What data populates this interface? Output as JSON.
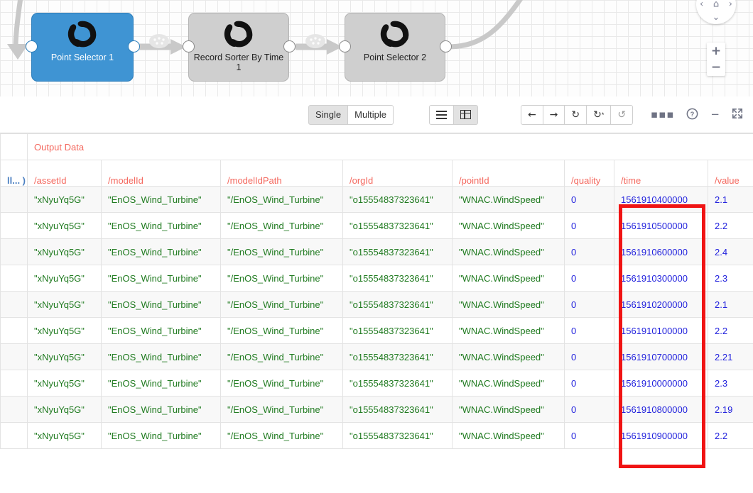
{
  "canvas": {
    "nodes": [
      {
        "label": "Point Selector 1",
        "icon": "pinwheel-icon",
        "state": "selected"
      },
      {
        "label": "Record Sorter By Time 1",
        "icon": "pinwheel-icon",
        "state": "normal"
      },
      {
        "label": "Point Selector 2",
        "icon": "pinwheel-icon",
        "state": "normal"
      }
    ],
    "nav": {
      "up": "⌃",
      "down": "⌄",
      "left": "‹",
      "right": "›",
      "home": "⌂",
      "zoom_in": "+",
      "zoom_out": "−"
    },
    "accent_selected": "#3f94d3",
    "accent_normal": "#cfcfcf"
  },
  "toolbar": {
    "mode_single": "Single",
    "mode_multiple": "Multiple",
    "active_mode": "Single",
    "view_list_icon": "list-view-icon",
    "view_grid_icon": "grid-view-icon",
    "active_view": "grid",
    "back_icon": "←",
    "forward_icon": "→",
    "refresh_icon": "↻",
    "refresh_star_icon": "↻",
    "reset_icon": "↺",
    "more_icon": "▪▪▪",
    "help_icon": "?",
    "minimize_icon": "−",
    "expand_icon": "⛶"
  },
  "grid": {
    "group_label": "Output Data",
    "columns": [
      {
        "key": "cut",
        "label": "ll... )"
      },
      {
        "key": "assetId",
        "label": "/assetId"
      },
      {
        "key": "modelId",
        "label": "/modelId"
      },
      {
        "key": "modelIdPath",
        "label": "/modelIdPath"
      },
      {
        "key": "orgId",
        "label": "/orgId"
      },
      {
        "key": "pointId",
        "label": "/pointId"
      },
      {
        "key": "quality",
        "label": "/quality"
      },
      {
        "key": "time",
        "label": "/time"
      },
      {
        "key": "value",
        "label": "/value"
      }
    ],
    "rows": [
      {
        "assetId": "\"xNyuYq5G\"",
        "modelId": "\"EnOS_Wind_Turbine\"",
        "modelIdPath": "\"/EnOS_Wind_Turbine\"",
        "orgId": "\"o15554837323641\"",
        "pointId": "\"WNAC.WindSpeed\"",
        "quality": "0",
        "time": "1561910400000",
        "value": "2.1"
      },
      {
        "assetId": "\"xNyuYq5G\"",
        "modelId": "\"EnOS_Wind_Turbine\"",
        "modelIdPath": "\"/EnOS_Wind_Turbine\"",
        "orgId": "\"o15554837323641\"",
        "pointId": "\"WNAC.WindSpeed\"",
        "quality": "0",
        "time": "1561910500000",
        "value": "2.2"
      },
      {
        "assetId": "\"xNyuYq5G\"",
        "modelId": "\"EnOS_Wind_Turbine\"",
        "modelIdPath": "\"/EnOS_Wind_Turbine\"",
        "orgId": "\"o15554837323641\"",
        "pointId": "\"WNAC.WindSpeed\"",
        "quality": "0",
        "time": "1561910600000",
        "value": "2.4"
      },
      {
        "assetId": "\"xNyuYq5G\"",
        "modelId": "\"EnOS_Wind_Turbine\"",
        "modelIdPath": "\"/EnOS_Wind_Turbine\"",
        "orgId": "\"o15554837323641\"",
        "pointId": "\"WNAC.WindSpeed\"",
        "quality": "0",
        "time": "1561910300000",
        "value": "2.3"
      },
      {
        "assetId": "\"xNyuYq5G\"",
        "modelId": "\"EnOS_Wind_Turbine\"",
        "modelIdPath": "\"/EnOS_Wind_Turbine\"",
        "orgId": "\"o15554837323641\"",
        "pointId": "\"WNAC.WindSpeed\"",
        "quality": "0",
        "time": "1561910200000",
        "value": "2.1"
      },
      {
        "assetId": "\"xNyuYq5G\"",
        "modelId": "\"EnOS_Wind_Turbine\"",
        "modelIdPath": "\"/EnOS_Wind_Turbine\"",
        "orgId": "\"o15554837323641\"",
        "pointId": "\"WNAC.WindSpeed\"",
        "quality": "0",
        "time": "1561910100000",
        "value": "2.2"
      },
      {
        "assetId": "\"xNyuYq5G\"",
        "modelId": "\"EnOS_Wind_Turbine\"",
        "modelIdPath": "\"/EnOS_Wind_Turbine\"",
        "orgId": "\"o15554837323641\"",
        "pointId": "\"WNAC.WindSpeed\"",
        "quality": "0",
        "time": "1561910700000",
        "value": "2.21"
      },
      {
        "assetId": "\"xNyuYq5G\"",
        "modelId": "\"EnOS_Wind_Turbine\"",
        "modelIdPath": "\"/EnOS_Wind_Turbine\"",
        "orgId": "\"o15554837323641\"",
        "pointId": "\"WNAC.WindSpeed\"",
        "quality": "0",
        "time": "1561910000000",
        "value": "2.3"
      },
      {
        "assetId": "\"xNyuYq5G\"",
        "modelId": "\"EnOS_Wind_Turbine\"",
        "modelIdPath": "\"/EnOS_Wind_Turbine\"",
        "orgId": "\"o15554837323641\"",
        "pointId": "\"WNAC.WindSpeed\"",
        "quality": "0",
        "time": "1561910800000",
        "value": "2.19"
      },
      {
        "assetId": "\"xNyuYq5G\"",
        "modelId": "\"EnOS_Wind_Turbine\"",
        "modelIdPath": "\"/EnOS_Wind_Turbine\"",
        "orgId": "\"o15554837323641\"",
        "pointId": "\"WNAC.WindSpeed\"",
        "quality": "0",
        "time": "1561910900000",
        "value": "2.2"
      }
    ],
    "annotation": {
      "color": "#f01414",
      "target_column": "/time"
    }
  }
}
